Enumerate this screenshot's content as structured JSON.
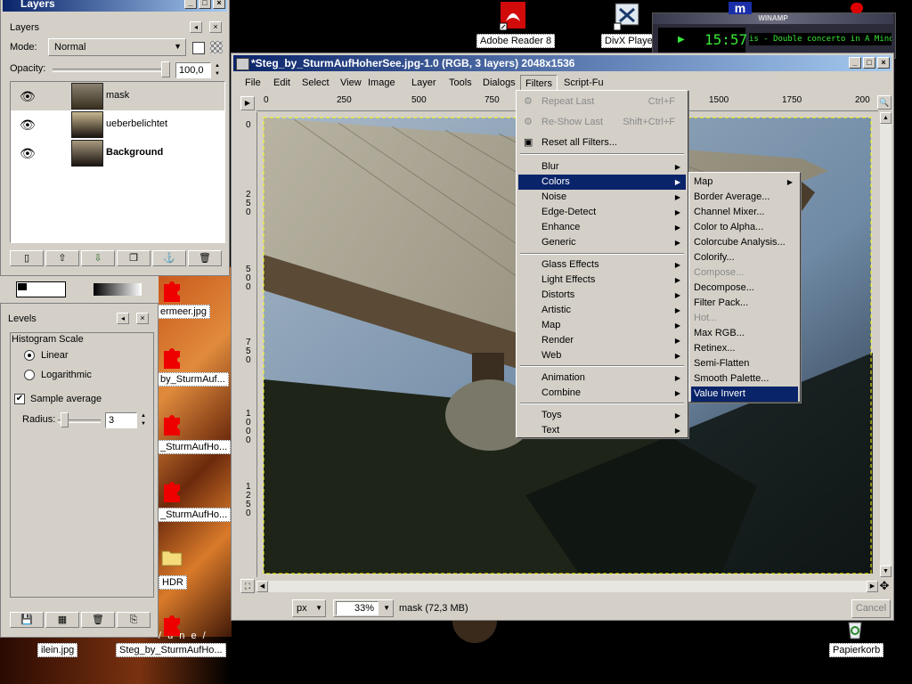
{
  "desktop": {
    "icons": [
      {
        "label": "Adobe Reader 8"
      },
      {
        "label": "DivX Player"
      },
      {
        "label": "ermeer.jpg"
      },
      {
        "label": "by_SturmAuf..."
      },
      {
        "label": "_SturmAufHo..."
      },
      {
        "label": "_SturmAufHo..."
      },
      {
        "label": "HDR"
      },
      {
        "label": "ilein.jpg"
      },
      {
        "label": "Steg_by_SturmAufHo..."
      },
      {
        "label": "Papierkorb"
      }
    ],
    "bottom_text": "/ u n e /"
  },
  "winamp": {
    "title": "WINAMP",
    "time": "15:57",
    "track": "is - Double concerto in A Minor fo"
  },
  "layers_dialog": {
    "window_title": "Layers",
    "panel_title": "Layers",
    "mode_label": "Mode:",
    "mode_value": "Normal",
    "opacity_label": "Opacity:",
    "opacity_value": "100,0",
    "layers": [
      {
        "name": "mask",
        "bold": false,
        "selected": false
      },
      {
        "name": "ueberbelichtet",
        "bold": false,
        "selected": true
      },
      {
        "name": "Background",
        "bold": true,
        "selected": true
      }
    ]
  },
  "levels_dialog": {
    "title": "Levels",
    "histogram_scale_label": "Histogram Scale",
    "linear_label": "Linear",
    "logarithmic_label": "Logarithmic",
    "sample_average_label": "Sample average",
    "radius_label": "Radius:",
    "radius_value": "3"
  },
  "image_window": {
    "title": "*Steg_by_SturmAufHoherSee.jpg-1.0 (RGB, 3 layers) 2048x1536",
    "menubar": [
      "File",
      "Edit",
      "Select",
      "View",
      "Image",
      "Layer",
      "Tools",
      "Dialogs",
      "Filters",
      "Script-Fu"
    ],
    "ruler_h": [
      "0",
      "250",
      "500",
      "750",
      "1500",
      "1750",
      "200"
    ],
    "ruler_v": [
      "0",
      "250",
      "500",
      "750",
      "1000",
      "1250"
    ],
    "unit": "px",
    "zoom": "33%",
    "status": "mask (72,3 MB)",
    "cancel_label": "Cancel"
  },
  "filters_menu": {
    "items": [
      {
        "label": "Repeat Last",
        "accel": "Ctrl+F",
        "disabled": true
      },
      {
        "label": "Re-Show Last",
        "accel": "Shift+Ctrl+F",
        "disabled": true
      },
      {
        "label": "Reset all Filters..."
      },
      {
        "label": "Blur",
        "sub": true
      },
      {
        "label": "Colors",
        "sub": true,
        "selected": true
      },
      {
        "label": "Noise",
        "sub": true
      },
      {
        "label": "Edge-Detect",
        "sub": true
      },
      {
        "label": "Enhance",
        "sub": true
      },
      {
        "label": "Generic",
        "sub": true
      },
      {
        "label": "Glass Effects",
        "sub": true
      },
      {
        "label": "Light Effects",
        "sub": true
      },
      {
        "label": "Distorts",
        "sub": true
      },
      {
        "label": "Artistic",
        "sub": true
      },
      {
        "label": "Map",
        "sub": true
      },
      {
        "label": "Render",
        "sub": true
      },
      {
        "label": "Web",
        "sub": true
      },
      {
        "label": "Animation",
        "sub": true
      },
      {
        "label": "Combine",
        "sub": true
      },
      {
        "label": "Toys",
        "sub": true
      },
      {
        "label": "Text",
        "sub": true
      }
    ]
  },
  "colors_submenu": {
    "items": [
      {
        "label": "Map",
        "sub": true
      },
      {
        "label": "Border Average..."
      },
      {
        "label": "Channel Mixer..."
      },
      {
        "label": "Color to Alpha..."
      },
      {
        "label": "Colorcube Analysis..."
      },
      {
        "label": "Colorify..."
      },
      {
        "label": "Compose...",
        "disabled": true
      },
      {
        "label": "Decompose..."
      },
      {
        "label": "Filter Pack..."
      },
      {
        "label": "Hot...",
        "disabled": true
      },
      {
        "label": "Max RGB..."
      },
      {
        "label": "Retinex..."
      },
      {
        "label": "Semi-Flatten"
      },
      {
        "label": "Smooth Palette..."
      },
      {
        "label": "Value Invert",
        "selected": true
      }
    ]
  }
}
